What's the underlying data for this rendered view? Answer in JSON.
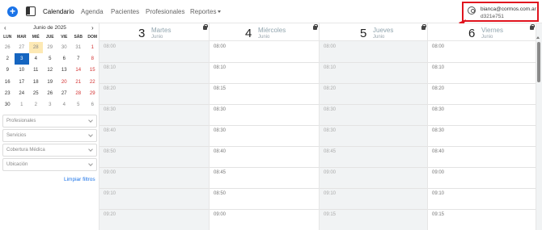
{
  "nav": {
    "items": [
      "Calendario",
      "Agenda",
      "Pacientes",
      "Profesionales",
      "Reportes"
    ]
  },
  "user": {
    "email": "bianca@cormos.com.ar",
    "id": "d321e751"
  },
  "mini_calendar": {
    "prev": "‹",
    "next": "›",
    "title": "Junio de 2025",
    "weekdays": [
      "LUN",
      "MAR",
      "MIÉ",
      "JUE",
      "VIE",
      "SÁB",
      "DOM"
    ],
    "weeks": [
      [
        "26",
        "27",
        "28",
        "29",
        "30",
        "31",
        "1"
      ],
      [
        "2",
        "3",
        "4",
        "5",
        "6",
        "7",
        "8"
      ],
      [
        "9",
        "10",
        "11",
        "12",
        "13",
        "14",
        "15"
      ],
      [
        "16",
        "17",
        "18",
        "19",
        "20",
        "21",
        "22"
      ],
      [
        "23",
        "24",
        "25",
        "26",
        "27",
        "28",
        "29"
      ],
      [
        "30",
        "1",
        "2",
        "3",
        "4",
        "5",
        "6"
      ]
    ]
  },
  "filters": {
    "professionals": "Profesionales",
    "services": "Servicios",
    "coverage": "Cobertura Médica",
    "location": "Ubicación",
    "clear": "Limpiar filtros"
  },
  "columns": [
    {
      "num": "3",
      "name": "Martes",
      "month": "Junio",
      "times": [
        "08:00",
        "08:10",
        "08:20",
        "08:30",
        "08:40",
        "08:50",
        "09:00",
        "09:10",
        "09:20"
      ]
    },
    {
      "num": "4",
      "name": "Miércoles",
      "month": "Junio",
      "times": [
        "08:00",
        "08:10",
        "08:15",
        "08:30",
        "08:30",
        "08:40",
        "08:45",
        "08:50",
        "09:00"
      ]
    },
    {
      "num": "5",
      "name": "Jueves",
      "month": "Junio",
      "times": [
        "08:00",
        "08:10",
        "08:20",
        "08:30",
        "08:30",
        "08:45",
        "09:00",
        "09:10",
        "09:15"
      ]
    },
    {
      "num": "6",
      "name": "Viernes",
      "month": "Junio",
      "times": [
        "08:00",
        "08:10",
        "08:20",
        "08:30",
        "08:30",
        "08:40",
        "09:00",
        "09:10",
        "09:15"
      ]
    }
  ],
  "colors": {
    "accent": "#1a73e8",
    "selected_day": "#1565c0",
    "today_highlight": "#fde9b4",
    "annotation_red": "#e0141e"
  }
}
